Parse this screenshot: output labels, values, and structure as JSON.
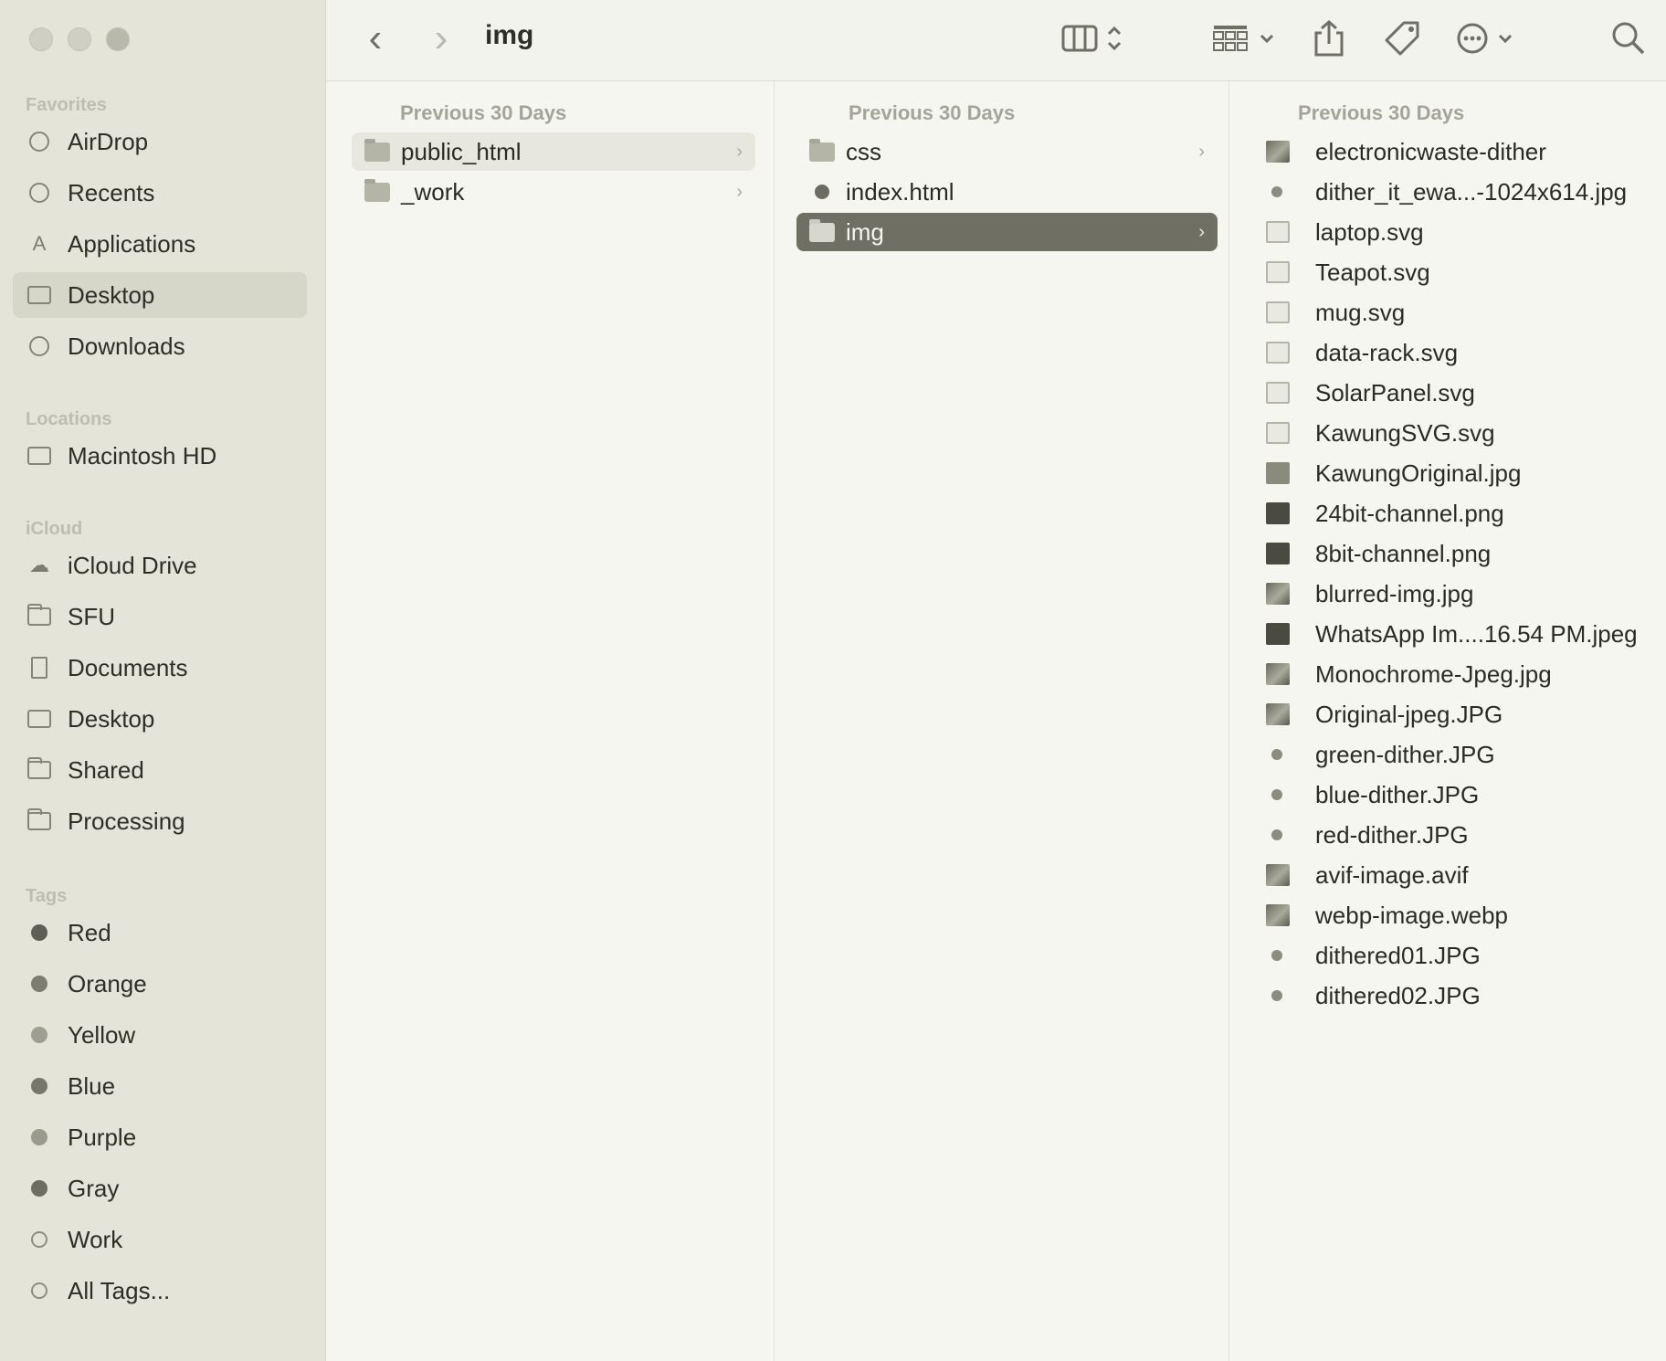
{
  "window": {
    "title": "img"
  },
  "sidebar": {
    "favorites_heading": "Favorites",
    "favorites": [
      {
        "label": "AirDrop",
        "icon": "airdrop-icon"
      },
      {
        "label": "Recents",
        "icon": "clock-icon"
      },
      {
        "label": "Applications",
        "icon": "applications-icon"
      },
      {
        "label": "Desktop",
        "icon": "desktop-icon",
        "selected": true
      },
      {
        "label": "Downloads",
        "icon": "download-icon"
      }
    ],
    "locations_heading": "Locations",
    "locations": [
      {
        "label": "Macintosh HD",
        "icon": "hard-drive-icon"
      }
    ],
    "icloud_heading": "iCloud",
    "icloud": [
      {
        "label": "iCloud Drive",
        "icon": "cloud-icon"
      },
      {
        "label": "SFU",
        "icon": "folder-icon"
      },
      {
        "label": "Documents",
        "icon": "document-icon"
      },
      {
        "label": "Desktop",
        "icon": "desktop-icon"
      },
      {
        "label": "Shared",
        "icon": "shared-folder-icon"
      },
      {
        "label": "Processing",
        "icon": "folder-icon"
      }
    ],
    "tags_heading": "Tags",
    "tags": [
      {
        "label": "Red",
        "color": "#5e5e54"
      },
      {
        "label": "Orange",
        "color": "#7d7d71"
      },
      {
        "label": "Yellow",
        "color": "#9e9e91"
      },
      {
        "label": "Blue",
        "color": "#77776b"
      },
      {
        "label": "Purple",
        "color": "#9a9a8d"
      },
      {
        "label": "Gray",
        "color": "#6d6d62"
      },
      {
        "label": "Work",
        "color": "hollow"
      },
      {
        "label": "All Tags...",
        "color": "all-tags"
      }
    ]
  },
  "toolbar": {
    "back": "‹",
    "forward": "›",
    "view_icon": "columns-view-icon",
    "group_icon": "group-icon",
    "share_icon": "share-icon",
    "tag_icon": "tag-icon",
    "more_icon": "more-icon",
    "search_icon": "search-icon"
  },
  "columns": [
    {
      "header": "Previous 30 Days",
      "items": [
        {
          "name": "public_html",
          "type": "folder",
          "chevron": "›",
          "state": "highlighted"
        },
        {
          "name": "_work",
          "type": "folder",
          "chevron": "›",
          "state": ""
        }
      ]
    },
    {
      "header": "Previous 30 Days",
      "items": [
        {
          "name": "css",
          "type": "folder",
          "chevron": "›",
          "state": ""
        },
        {
          "name": "index.html",
          "type": "html",
          "chevron": "",
          "state": ""
        },
        {
          "name": "img",
          "type": "folder",
          "chevron": "›",
          "state": "selected"
        }
      ]
    },
    {
      "header": "Previous 30 Days",
      "items": [
        {
          "name": "electronicwaste-dither",
          "thumb": "photo"
        },
        {
          "name": "dither_it_ewa...-1024x614.jpg",
          "thumb": "dither"
        },
        {
          "name": "laptop.svg",
          "thumb": "light"
        },
        {
          "name": "Teapot.svg",
          "thumb": "light"
        },
        {
          "name": "mug.svg",
          "thumb": "light"
        },
        {
          "name": "data-rack.svg",
          "thumb": "light"
        },
        {
          "name": "SolarPanel.svg",
          "thumb": "light"
        },
        {
          "name": "KawungSVG.svg",
          "thumb": "light"
        },
        {
          "name": "KawungOriginal.jpg",
          "thumb": "mid"
        },
        {
          "name": "24bit-channel.png",
          "thumb": "dark"
        },
        {
          "name": "8bit-channel.png",
          "thumb": "dark"
        },
        {
          "name": "blurred-img.jpg",
          "thumb": "photo"
        },
        {
          "name": "WhatsApp Im....16.54 PM.jpeg",
          "thumb": "dark"
        },
        {
          "name": "Monochrome-Jpeg.jpg",
          "thumb": "photo"
        },
        {
          "name": "Original-jpeg.JPG",
          "thumb": "photo"
        },
        {
          "name": "green-dither.JPG",
          "thumb": "dither"
        },
        {
          "name": "blue-dither.JPG",
          "thumb": "dither"
        },
        {
          "name": "red-dither.JPG",
          "thumb": "dither"
        },
        {
          "name": "avif-image.avif",
          "thumb": "photo"
        },
        {
          "name": "webp-image.webp",
          "thumb": "photo"
        },
        {
          "name": "dithered01.JPG",
          "thumb": "dither"
        },
        {
          "name": "dithered02.JPG",
          "thumb": "dither"
        }
      ]
    }
  ]
}
